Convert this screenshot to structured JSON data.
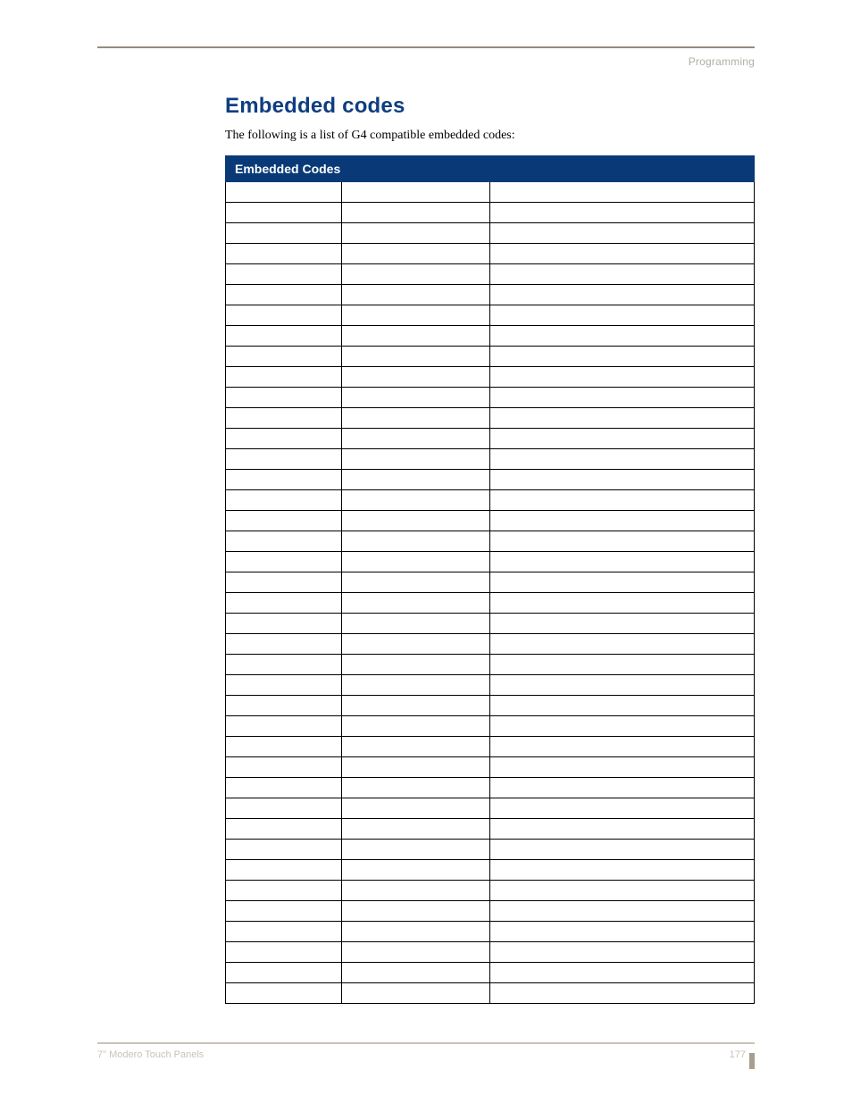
{
  "header": {
    "right": "Programming"
  },
  "section": {
    "title": "Embedded codes",
    "lead": "The following is a list of G4 compatible embedded codes:"
  },
  "table": {
    "title": "Embedded Codes",
    "row_count": 40,
    "columns": 3
  },
  "footer": {
    "left": "7\" Modero Touch Panels",
    "page": "177"
  }
}
